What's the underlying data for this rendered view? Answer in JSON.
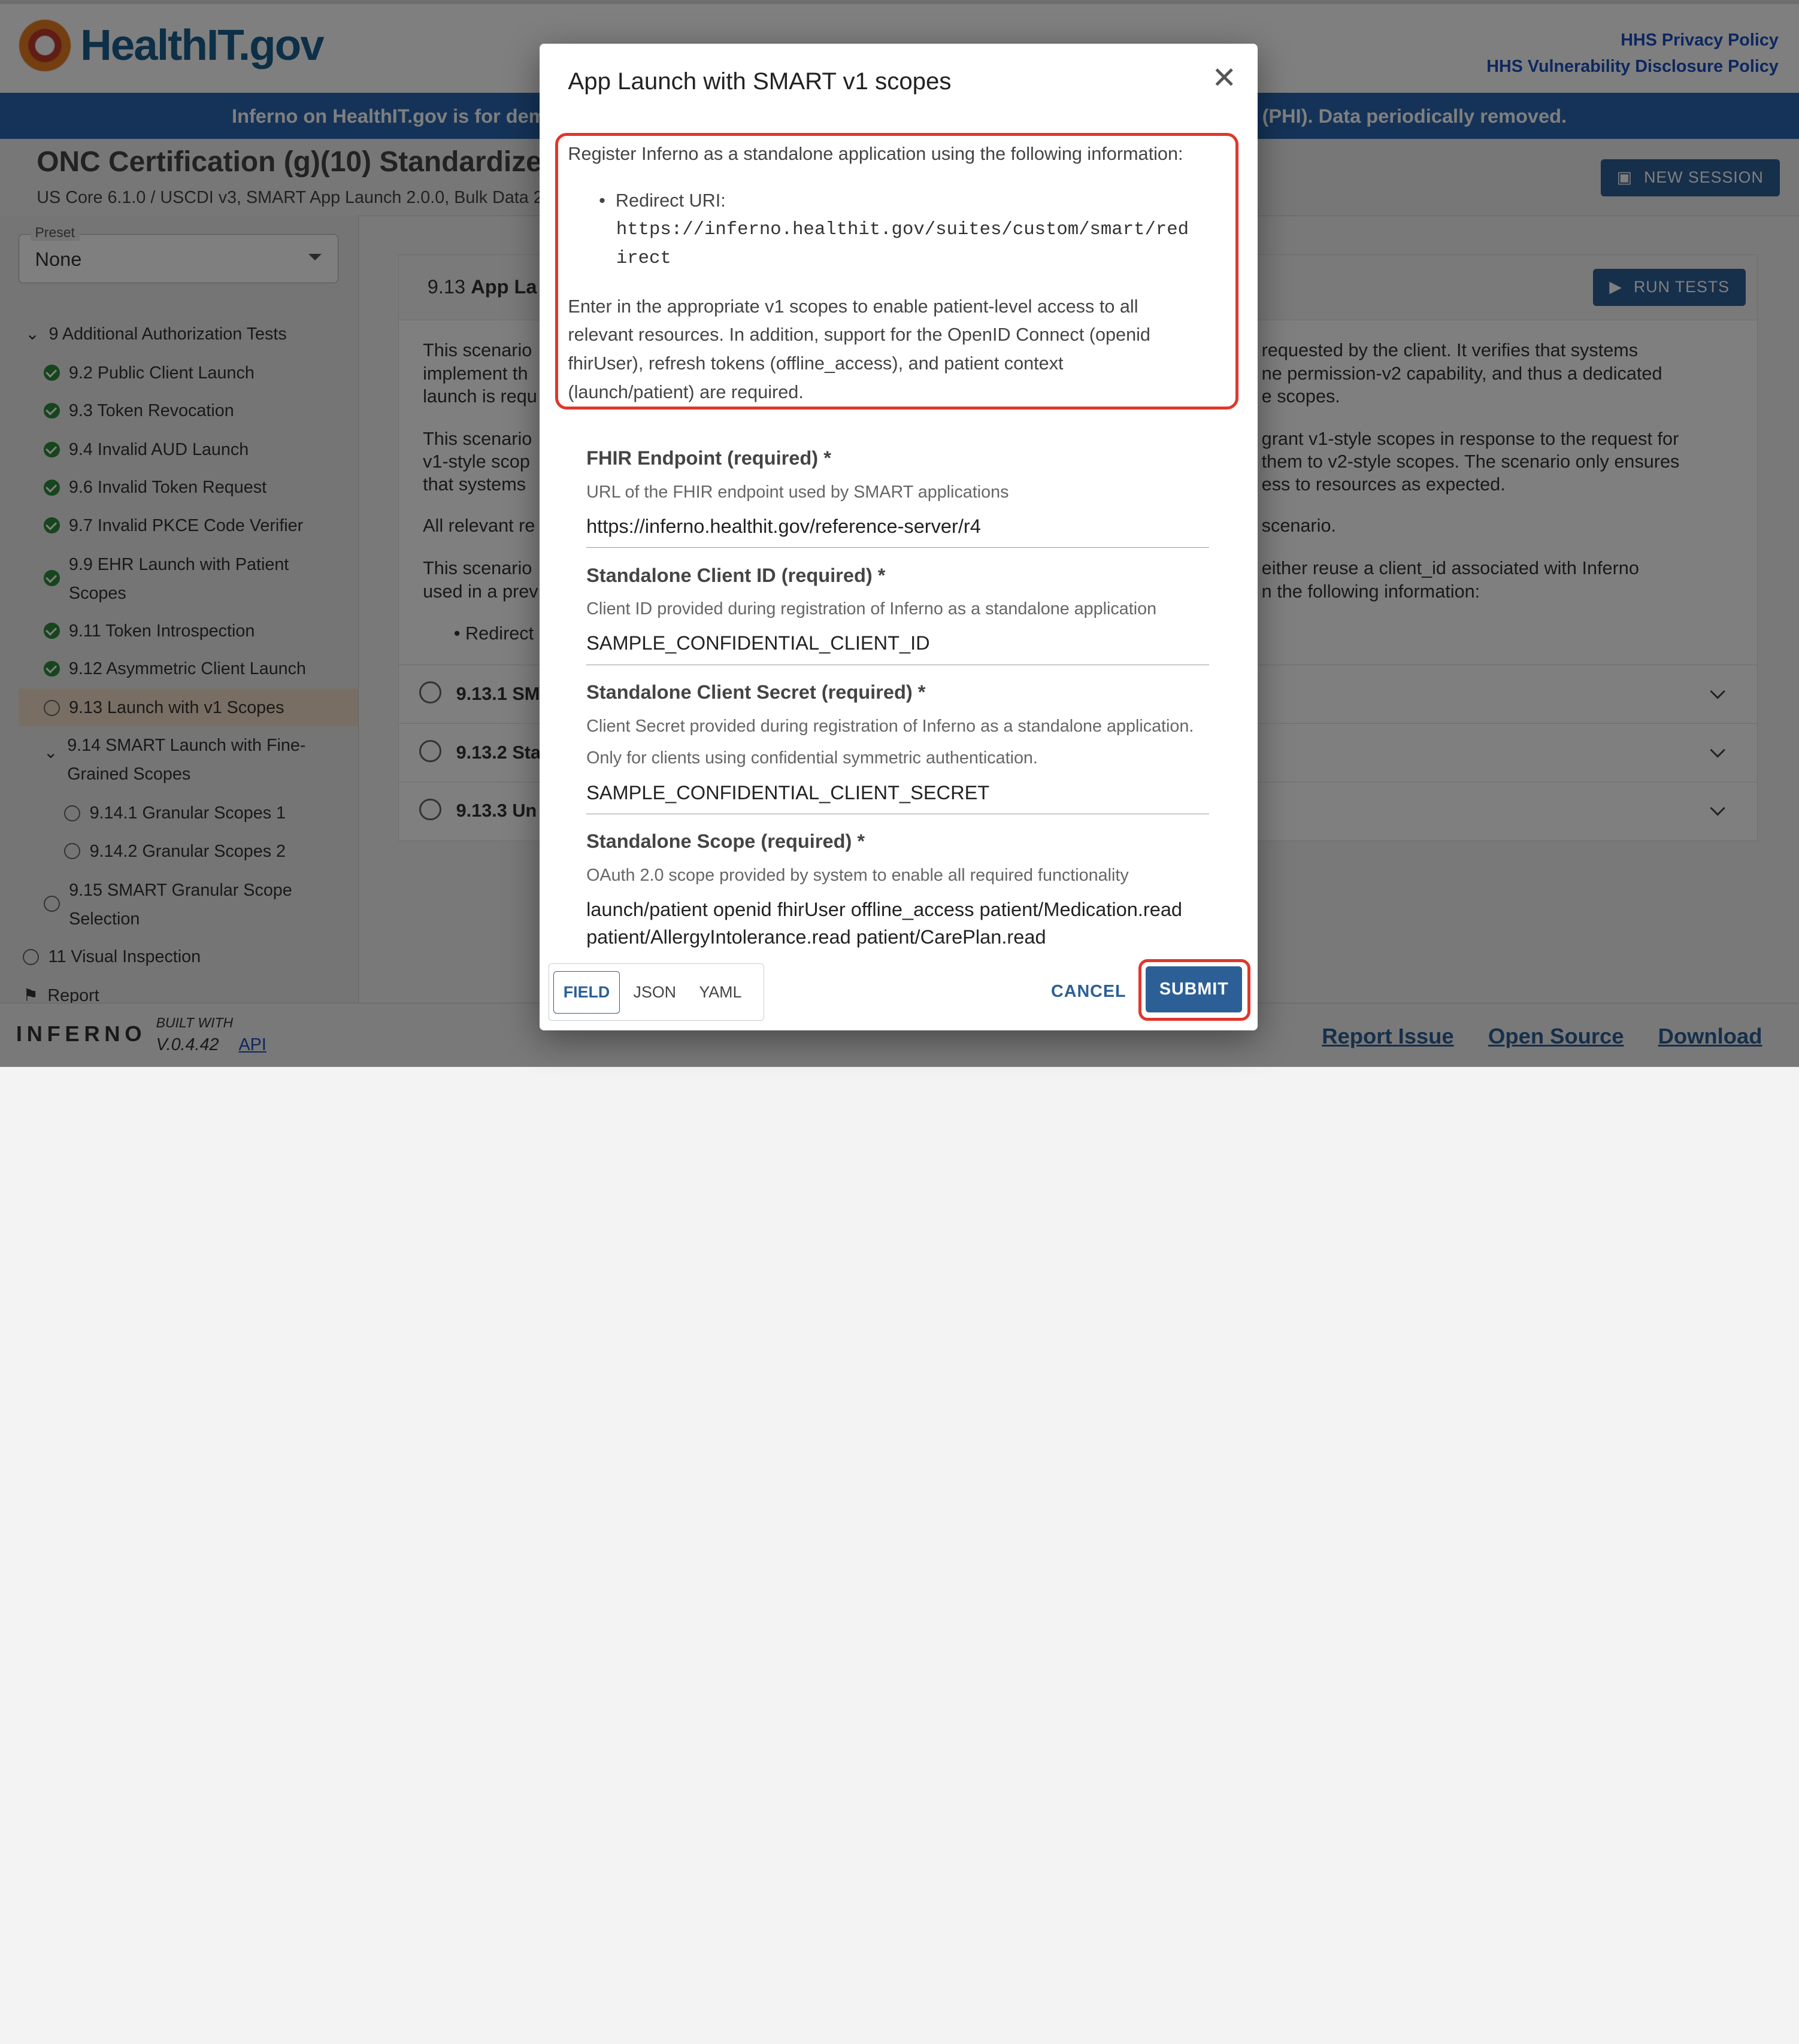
{
  "header": {
    "logo_text": "HealthIT.gov",
    "privacy_link": "HHS Privacy Policy",
    "vuln_link": "HHS Vulnerability Disclosure Policy",
    "banner_left": "Inferno on HealthIT.gov is for dem",
    "banner_right": "(PHI). Data periodically removed."
  },
  "suite": {
    "title": "ONC Certification (g)(10) Standardize",
    "subtitle": "US Core 6.1.0 / USCDI v3, SMART App Launch 2.0.0, Bulk Data 2",
    "new_session": "NEW SESSION"
  },
  "sidebar": {
    "preset_label": "Preset",
    "preset_value": "None",
    "items": [
      {
        "label": "9 Additional Authorization Tests"
      },
      {
        "label": "9.2 Public Client Launch"
      },
      {
        "label": "9.3 Token Revocation"
      },
      {
        "label": "9.4 Invalid AUD Launch"
      },
      {
        "label": "9.6 Invalid Token Request"
      },
      {
        "label": "9.7 Invalid PKCE Code Verifier"
      },
      {
        "label": "9.9 EHR Launch with Patient Scopes"
      },
      {
        "label": "9.11 Token Introspection"
      },
      {
        "label": "9.12 Asymmetric Client Launch"
      },
      {
        "label": "9.13 Launch with v1 Scopes"
      },
      {
        "label": "9.14 SMART Launch with Fine-Grained Scopes"
      },
      {
        "label": "9.14.1 Granular Scopes 1"
      },
      {
        "label": "9.14.2 Granular Scopes 2"
      },
      {
        "label": "9.15 SMART Granular Scope Selection"
      },
      {
        "label": "11 Visual Inspection"
      },
      {
        "label": "Report"
      }
    ]
  },
  "main": {
    "title_num": "9.13",
    "title_text": "App La",
    "run_tests": "RUN TESTS",
    "left_para1": [
      "This scenario",
      "implement th",
      "launch is requ"
    ],
    "left_para2": [
      "This scenario",
      "v1-style scop",
      "that systems"
    ],
    "left_para3": "All relevant re",
    "left_para4": [
      "This scenario",
      "used in a prev"
    ],
    "left_bullet": "Redirect",
    "right_para1": [
      "requested by the client. It verifies that systems",
      "ne permission-v2 capability, and thus a dedicated",
      "e scopes."
    ],
    "right_para2": [
      "grant v1-style scopes in response to the request for",
      "them to v2-style scopes. The scenario only ensures",
      "ess to resources as expected."
    ],
    "right_para3": "scenario.",
    "right_para4": [
      "either reuse a client_id associated with Inferno",
      "n the following information:"
    ],
    "rows": [
      {
        "num": "9.13.1",
        "label": "SM"
      },
      {
        "num": "9.13.2",
        "label": "Sta"
      },
      {
        "num": "9.13.3",
        "label": "Un"
      }
    ]
  },
  "modal": {
    "title": "App Launch with SMART v1 scopes",
    "intro": "Register Inferno as a standalone application using the following information:",
    "redirect_label": "Redirect URI:",
    "redirect_uri_1": "https://inferno.healthit.gov/suites/custom/smart/red",
    "redirect_uri_2": "irect",
    "scopes_text": [
      "Enter in the appropriate v1 scopes to enable patient-level access to all",
      "relevant resources. In addition, support for the OpenID Connect (openid",
      "fhirUser), refresh tokens (offline_access), and patient context",
      "(launch/patient) are required."
    ],
    "fields": [
      {
        "label": "FHIR Endpoint (required) *",
        "help": "URL of the FHIR endpoint used by SMART applications",
        "value": "https://inferno.healthit.gov/reference-server/r4"
      },
      {
        "label": "Standalone Client ID (required) *",
        "help": "Client ID provided during registration of Inferno as a standalone application",
        "value": "SAMPLE_CONFIDENTIAL_CLIENT_ID"
      },
      {
        "label": "Standalone Client Secret (required) *",
        "help": "Client Secret provided during registration of Inferno as a standalone application. Only for clients using confidential symmetric authentication.",
        "value": "SAMPLE_CONFIDENTIAL_CLIENT_SECRET"
      },
      {
        "label": "Standalone Scope (required) *",
        "help": "OAuth 2.0 scope provided by system to enable all required functionality",
        "value": "launch/patient openid fhirUser offline_access patient/Medication.read patient/AllergyIntolerance.read patient/CarePlan.read"
      }
    ],
    "toggle": [
      "FIELD",
      "JSON",
      "YAML"
    ],
    "cancel": "CANCEL",
    "submit": "SUBMIT"
  },
  "footer": {
    "brand": "INFERNO",
    "built_with": "BUILT WITH",
    "version": "V.0.4.42",
    "api": "API",
    "report_issue": "Report Issue",
    "open_source": "Open Source",
    "download": "Download"
  },
  "colors": {
    "accent": "#2c5f96",
    "banner": "#2a67b1",
    "highlight": "#e0372c",
    "pass": "#2e8b3a",
    "selected": "#f0ddc6"
  }
}
